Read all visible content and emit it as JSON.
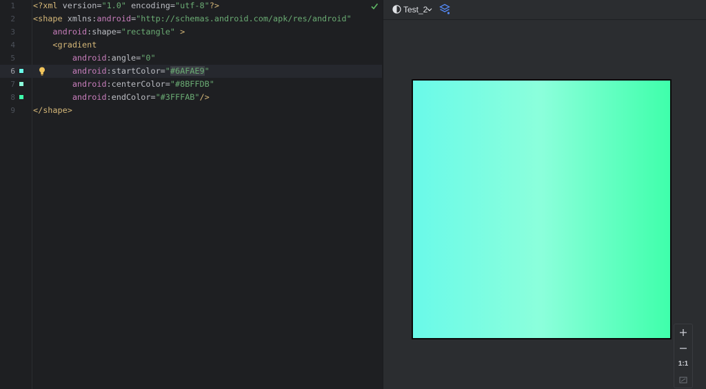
{
  "editor": {
    "lines": [
      {
        "number": "1",
        "tokens": [
          {
            "t": "<?",
            "c": "t-tag"
          },
          {
            "t": "xml ",
            "c": "t-tag"
          },
          {
            "t": "version=",
            "c": "t-attr"
          },
          {
            "t": "\"1.0\"",
            "c": "t-str"
          },
          {
            "t": " encoding=",
            "c": "t-attr"
          },
          {
            "t": "\"utf-8\"",
            "c": "t-str"
          },
          {
            "t": "?>",
            "c": "t-tag"
          }
        ]
      },
      {
        "number": "2",
        "tokens": [
          {
            "t": "<shape ",
            "c": "t-tag"
          },
          {
            "t": "xmlns:",
            "c": "t-attr"
          },
          {
            "t": "android",
            "c": "t-ns"
          },
          {
            "t": "=",
            "c": "t-attr"
          },
          {
            "t": "\"http://schemas.android.com/apk/res/android\"",
            "c": "t-str"
          }
        ]
      },
      {
        "number": "3",
        "tokens": [
          {
            "t": "    ",
            "c": "t-attr"
          },
          {
            "t": "android",
            "c": "t-ns"
          },
          {
            "t": ":shape=",
            "c": "t-attr"
          },
          {
            "t": "\"rectangle\"",
            "c": "t-str"
          },
          {
            "t": " >",
            "c": "t-tag"
          }
        ]
      },
      {
        "number": "4",
        "tokens": [
          {
            "t": "    ",
            "c": "t-attr"
          },
          {
            "t": "<gradient",
            "c": "t-tag"
          }
        ]
      },
      {
        "number": "5",
        "tokens": [
          {
            "t": "        ",
            "c": "t-attr"
          },
          {
            "t": "android",
            "c": "t-ns"
          },
          {
            "t": ":angle=",
            "c": "t-attr"
          },
          {
            "t": "\"0\"",
            "c": "t-str"
          }
        ]
      },
      {
        "number": "6",
        "current": true,
        "swatch": "#6AFAE9",
        "bulb": true,
        "tokens": [
          {
            "t": "        ",
            "c": "t-attr"
          },
          {
            "t": "android",
            "c": "t-ns"
          },
          {
            "t": ":startColor=",
            "c": "t-attr"
          },
          {
            "t": "\"",
            "c": "t-str"
          },
          {
            "t": "#6AFAE9",
            "c": "t-str t-hl"
          },
          {
            "t": "\"",
            "c": "t-str"
          }
        ]
      },
      {
        "number": "7",
        "swatch": "#8BFFDB",
        "tokens": [
          {
            "t": "        ",
            "c": "t-attr"
          },
          {
            "t": "android",
            "c": "t-ns"
          },
          {
            "t": ":centerColor=",
            "c": "t-attr"
          },
          {
            "t": "\"#8BFFDB\"",
            "c": "t-str"
          }
        ]
      },
      {
        "number": "8",
        "swatch": "#3FFFAB",
        "tokens": [
          {
            "t": "        ",
            "c": "t-attr"
          },
          {
            "t": "android",
            "c": "t-ns"
          },
          {
            "t": ":endColor=",
            "c": "t-attr"
          },
          {
            "t": "\"#3FFFAB\"",
            "c": "t-str"
          },
          {
            "t": "/>",
            "c": "t-tag"
          }
        ]
      },
      {
        "number": "9",
        "tokens": [
          {
            "t": "</shape>",
            "c": "t-tag"
          }
        ]
      }
    ]
  },
  "preview": {
    "theme_label": "Test_2",
    "gradient": {
      "angle": "0",
      "start": "#6AFAE9",
      "center": "#8BFFDB",
      "end": "#3FFFAB"
    },
    "zoom": {
      "in_label": "+",
      "out_label": "−",
      "actual_size_label": "1:1"
    }
  },
  "icons": {
    "inspection_ok": "check-icon",
    "intention": "lightbulb-icon",
    "theme": "contrast-icon",
    "layers": "layers-icon",
    "fit": "fit-screen-icon"
  }
}
